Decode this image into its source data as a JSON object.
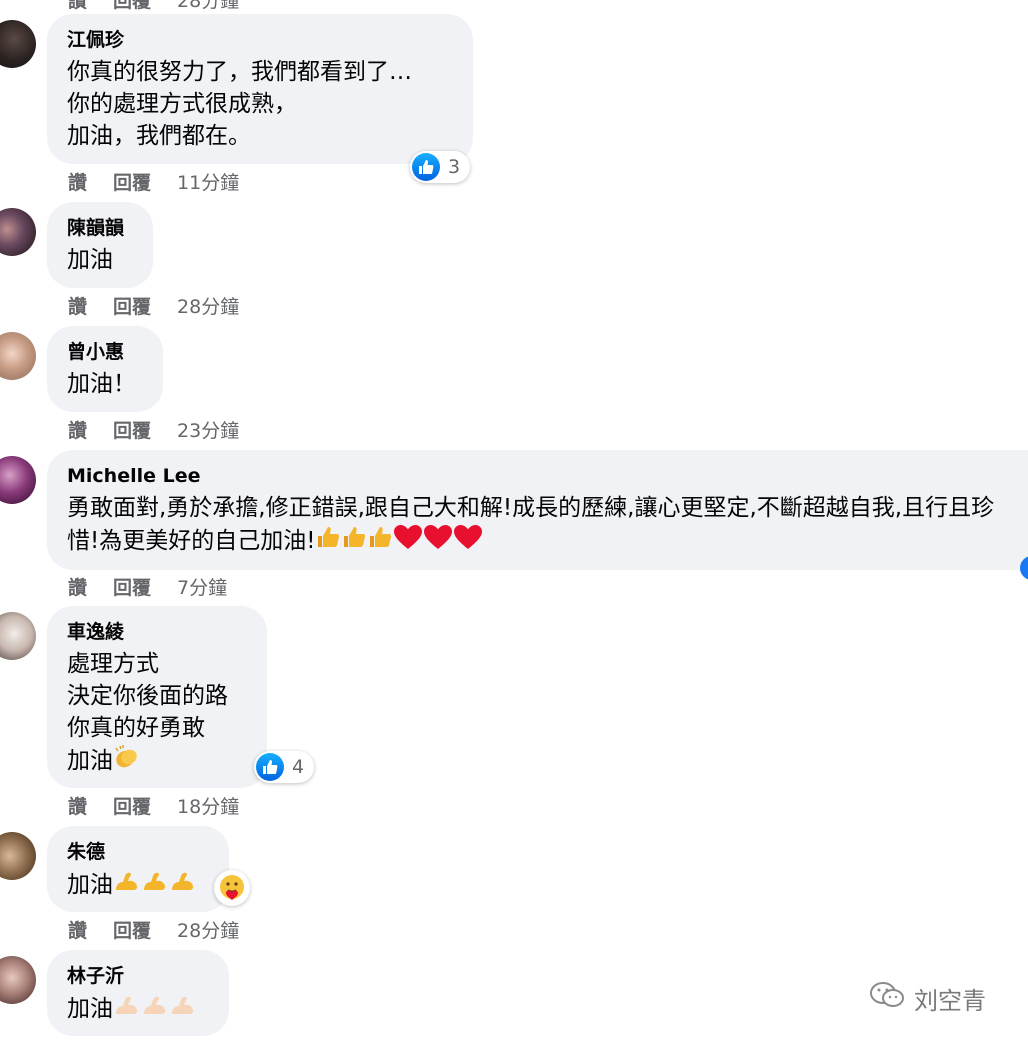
{
  "actions": {
    "like": "讚",
    "reply": "回覆"
  },
  "comments": [
    {
      "author": "江佩珍",
      "lines": [
        "你真的很努力了，我們都看到了…",
        "你的處理方式很成熟，",
        "加油，我們都在。"
      ],
      "time": "11分鐘",
      "likes": "3"
    },
    {
      "author": "陳韻韻",
      "lines": [
        "加油"
      ],
      "time": "28分鐘"
    },
    {
      "author": "曾小惠",
      "lines": [
        "加油！"
      ],
      "time": "23分鐘"
    },
    {
      "author": "Michelle Lee",
      "text": "勇敢面對,勇於承擔,修正錯誤,跟自己大和解!成長的歷練,讓心更堅定,不斷超越自我,且行且珍惜!為更美好的自己加油!",
      "time": "7分鐘"
    },
    {
      "author": "車逸綾",
      "lines": [
        "處理方式",
        "決定你後面的路",
        "你真的好勇敢",
        "加油"
      ],
      "time": "18分鐘",
      "likes": "4"
    },
    {
      "author": "朱德",
      "lines": [
        "加油"
      ],
      "time": "28分鐘"
    },
    {
      "author": "林子沂",
      "lines": [
        "加油"
      ]
    }
  ],
  "watermark": "刘空青",
  "colors": {
    "bubble": "#f0f2f5",
    "action_text": "#65676b",
    "like_blue": "#1877f2",
    "heart": "#e8102e"
  }
}
